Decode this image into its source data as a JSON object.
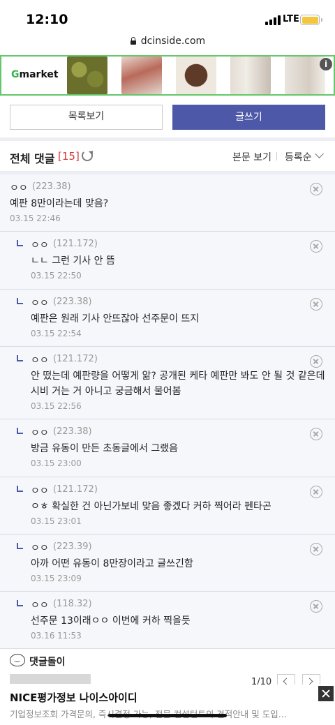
{
  "status": {
    "time": "12:10",
    "network": "LTE"
  },
  "browser": {
    "url": "dcinside.com"
  },
  "ad_banner": {
    "brand_prefix": "G",
    "brand_rest": "market",
    "info_label": "i",
    "thumb_colors": [
      "#8a8f3e",
      "#c9a08f",
      "#6e4a36",
      "#ddd7cf",
      "#e6e2dc"
    ]
  },
  "buttons": {
    "list_label": "목록보기",
    "write_label": "글쓰기"
  },
  "comments_header": {
    "title": "전체 댓글",
    "count": "[15]",
    "view_label": "본문 보기",
    "order_label": "등록순"
  },
  "comments": [
    {
      "nick": "ㅇㅇ",
      "ip": "(223.38)",
      "text": "예판 8만이라는데 맞음?",
      "date": "03.15 22:46",
      "reply": false
    },
    {
      "nick": "ㅇㅇ",
      "ip": "(121.172)",
      "text": "ㄴㄴ 그런 기사 안 뜸",
      "date": "03.15 22:50",
      "reply": true
    },
    {
      "nick": "ㅇㅇ",
      "ip": "(223.38)",
      "text": "예판은 원래 기사 안뜨잖아 선주문이 뜨지",
      "date": "03.15 22:54",
      "reply": true
    },
    {
      "nick": "ㅇㅇ",
      "ip": "(121.172)",
      "text_lines": [
        "안 떴는데 예판량을 어떻게 앎? 공개된 케타 예판만 봐도 안 될 것 같은데",
        "시비 거는 거 아니고 궁금해서 물어봄"
      ],
      "date": "03.15 22:56",
      "reply": true
    },
    {
      "nick": "ㅇㅇ",
      "ip": "(223.38)",
      "text": "방금 유동이 만든 초동글에서 그랬음",
      "date": "03.15 23:00",
      "reply": true
    },
    {
      "nick": "ㅇㅇ",
      "ip": "(121.172)",
      "text": "ㅇㅎ 확실한 건 아닌가보네 맞음 좋겠다 커하 찍어라 펜타곤",
      "date": "03.15 23:01",
      "reply": true
    },
    {
      "nick": "ㅇㅇ",
      "ip": "(223.39)",
      "text": "아까 어떤 유동이 8만장이라고 글쓰긴함",
      "date": "03.15 23:09",
      "reply": true
    },
    {
      "nick": "ㅇㅇ",
      "ip": "(118.32)",
      "text": "선주문 13이래ㅇㅇ 이번에 커하 찍을듯",
      "date": "03.16 11:53",
      "reply": true
    }
  ],
  "dolgi": {
    "title": "댓글돌이",
    "pager": "1/10"
  },
  "bottom_ad": {
    "title": "NICE평가정보 나이스아이디",
    "text": "기업정보조회 가격문의, 즉시결정 가능, 전문 컨설턴트의 견적안내 및 도입..."
  }
}
